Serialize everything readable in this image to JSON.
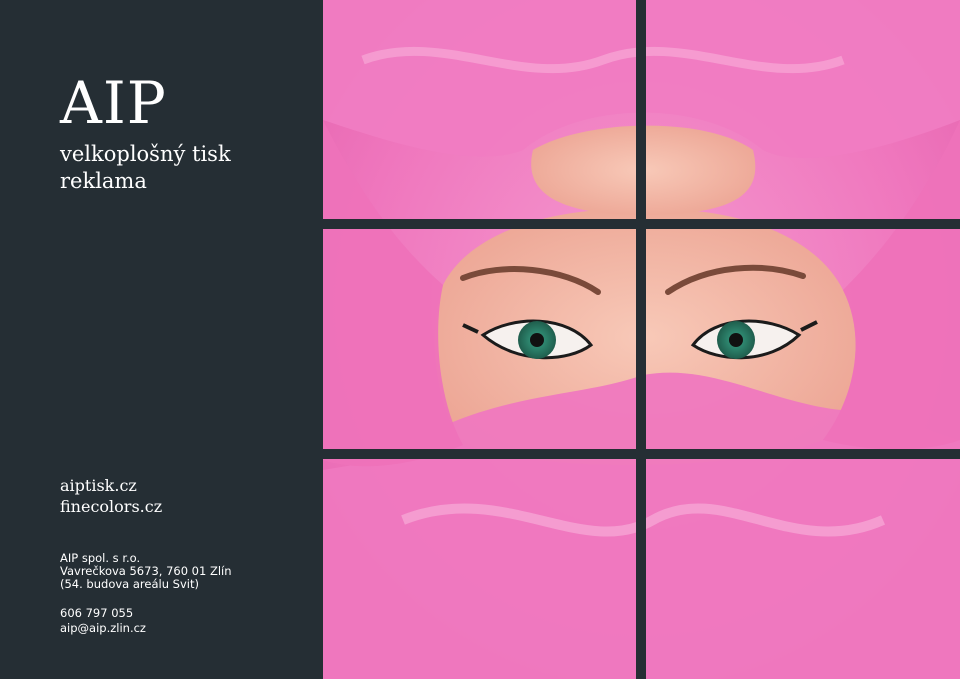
{
  "brand": {
    "name": "AIP",
    "tagline_line1": "velkoplošný tisk",
    "tagline_line2": "reklama"
  },
  "websites": [
    "aiptisk.cz",
    "finecolors.cz"
  ],
  "address": {
    "company": "AIP spol. s r.o.",
    "street": "Vavrečkova 5673, 760 01 Zlín",
    "note": "(54. budova areálu Svit)"
  },
  "contact": {
    "phone": "606 797 055",
    "email": "aip@aip.zlin.cz"
  },
  "colors": {
    "panel": "#252e34",
    "tulle": "#f07cc0",
    "skin": "#f3b6a6",
    "iris": "#2f8a72"
  }
}
